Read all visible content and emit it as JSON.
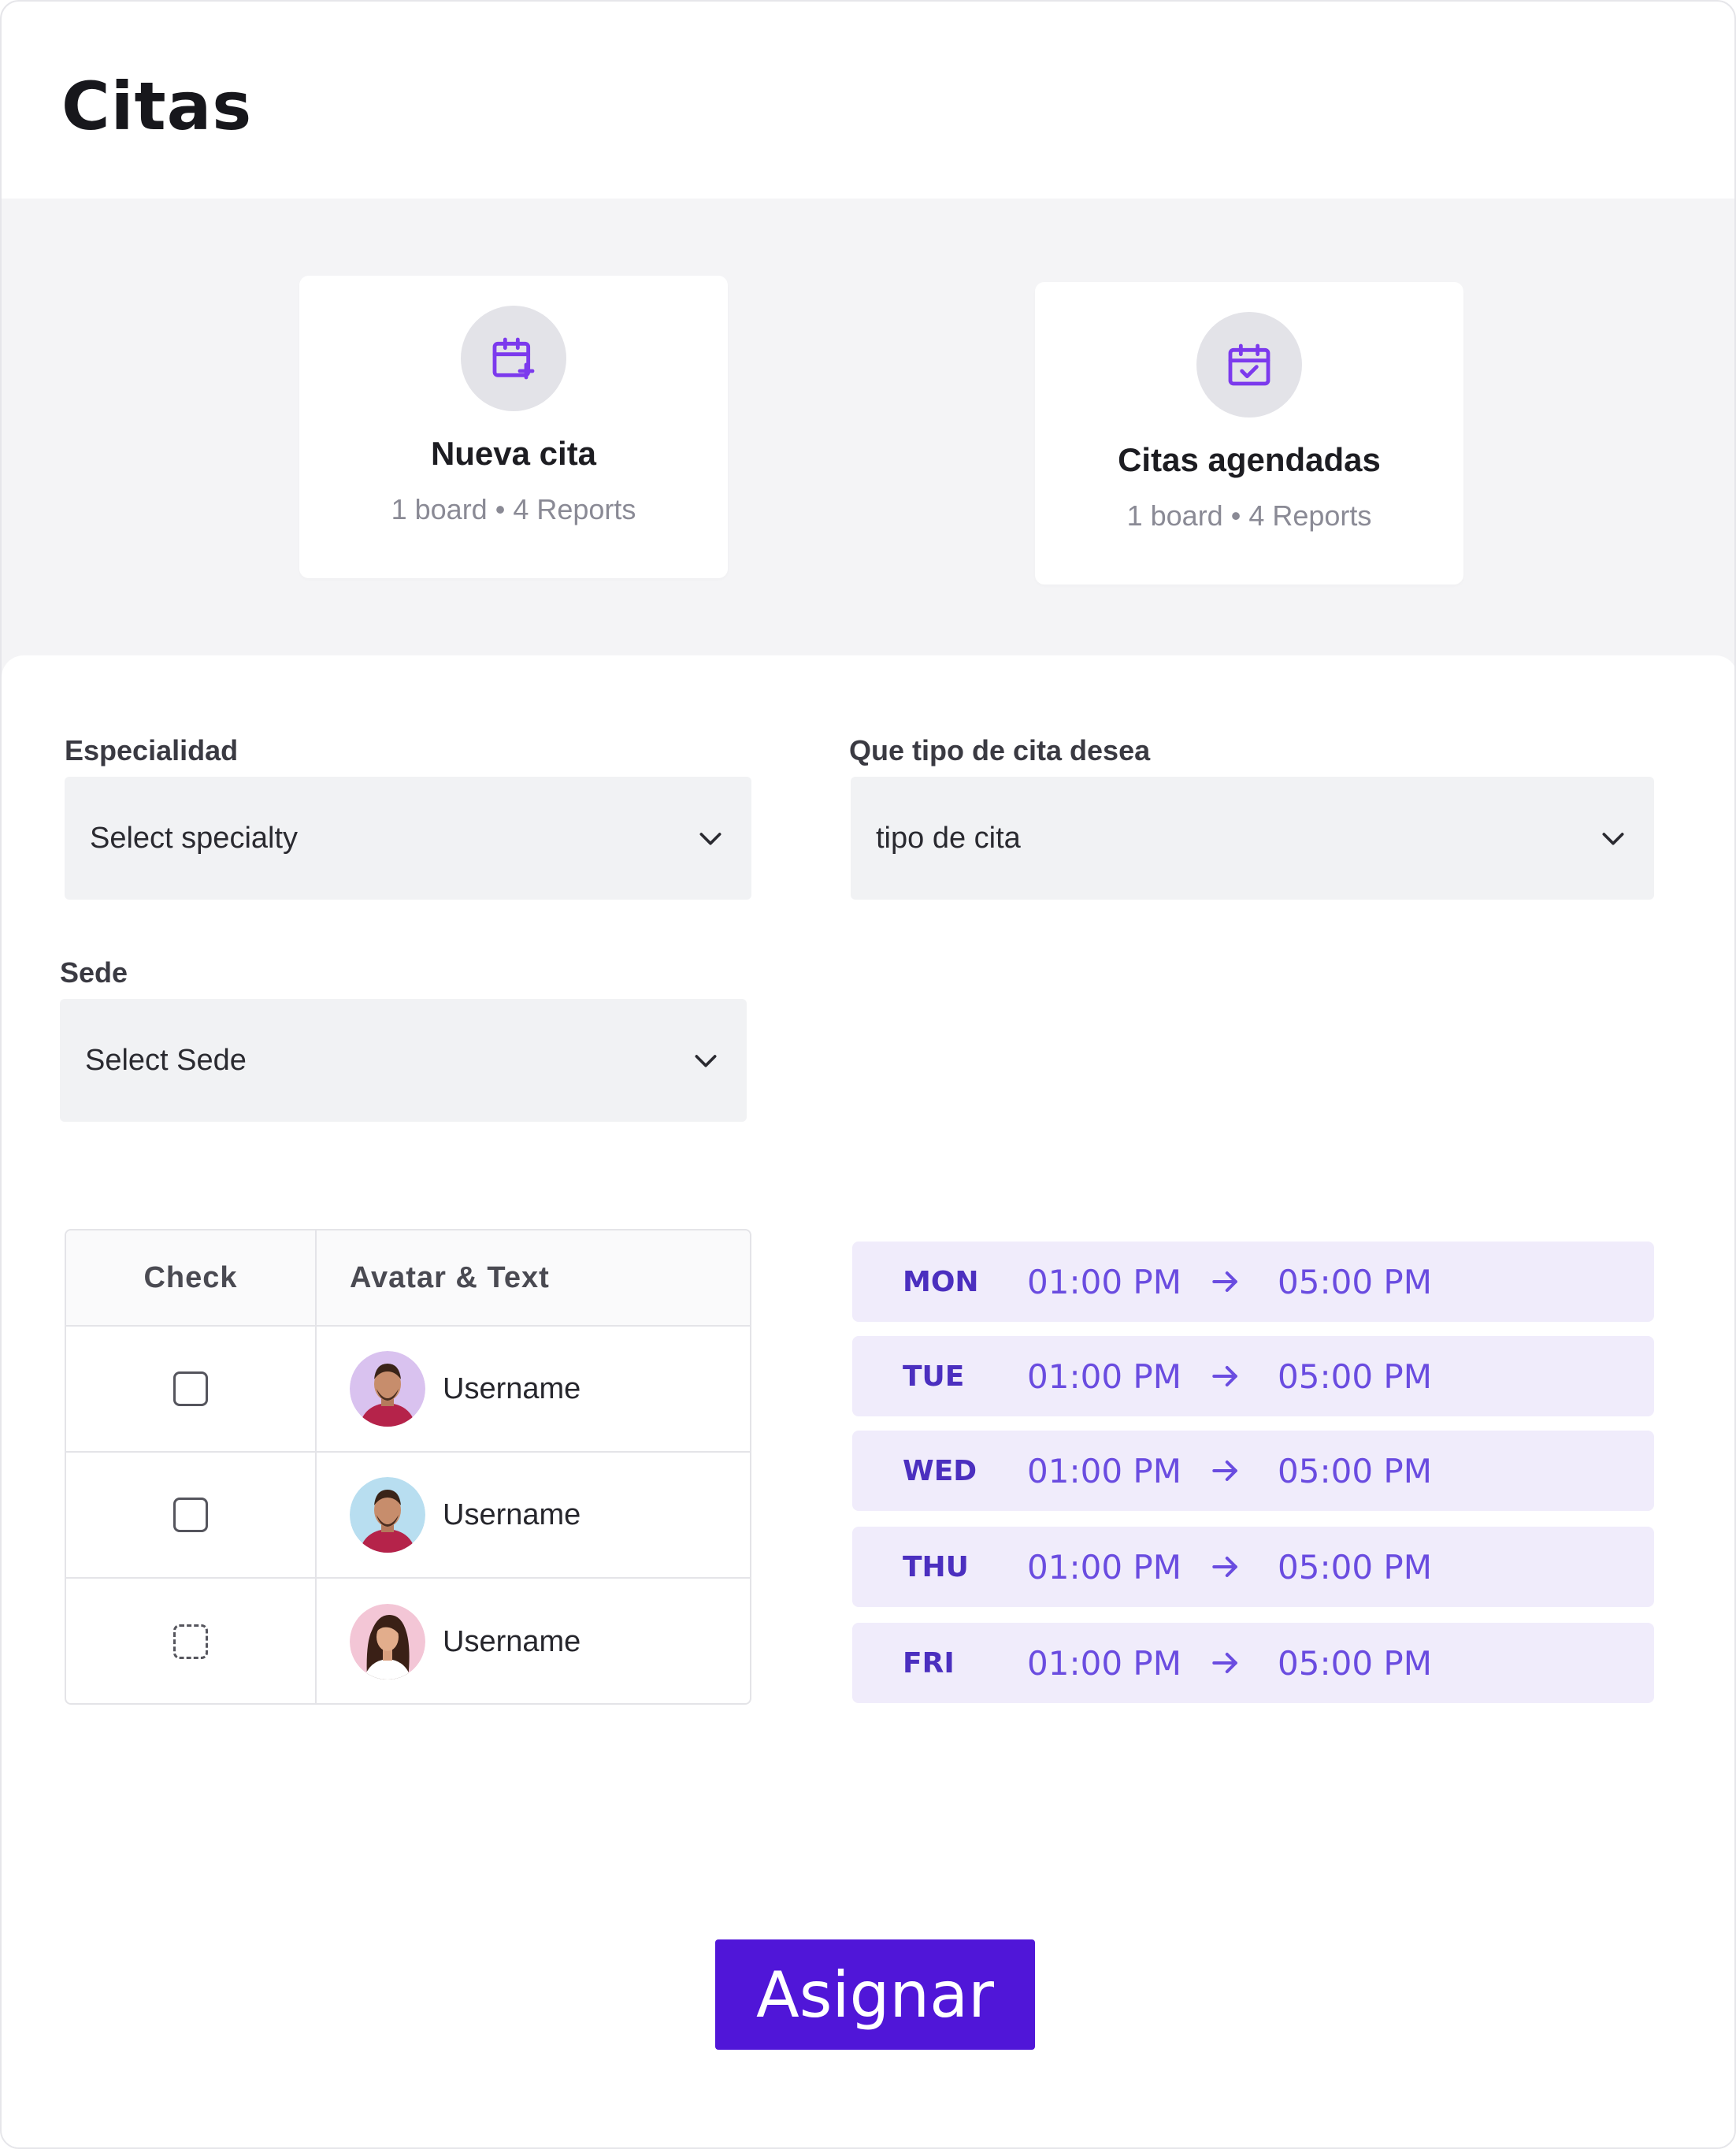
{
  "page": {
    "title": "Citas"
  },
  "cards": [
    {
      "title": "Nueva cita",
      "meta": "1 board • 4 Reports",
      "icon": "calendar-plus-icon"
    },
    {
      "title": "Citas agendadas",
      "meta": "1 board • 4 Reports",
      "icon": "calendar-check-icon"
    }
  ],
  "form": {
    "specialty": {
      "label": "Especialidad",
      "value": "Select  specialty"
    },
    "appointment_type": {
      "label": "Que tipo de cita desea",
      "value": "tipo de cita"
    },
    "site": {
      "label": "Sede",
      "value": "Select  Sede"
    }
  },
  "table": {
    "headers": {
      "check": "Check",
      "user": "Avatar & Text"
    },
    "rows": [
      {
        "username": "Username",
        "checked": false
      },
      {
        "username": "Username",
        "checked": false
      },
      {
        "username": "Username",
        "checked": false
      }
    ]
  },
  "schedule": [
    {
      "day": "MON",
      "from": "01:00 PM",
      "to": "05:00 PM"
    },
    {
      "day": "TUE",
      "from": "01:00 PM",
      "to": "05:00 PM"
    },
    {
      "day": "WED",
      "from": "01:00 PM",
      "to": "05:00 PM"
    },
    {
      "day": "THU",
      "from": "01:00 PM",
      "to": "05:00 PM"
    },
    {
      "day": "FRI",
      "from": "01:00 PM",
      "to": "05:00 PM"
    }
  ],
  "actions": {
    "assign_label": "Asignar"
  },
  "colors": {
    "accent": "#5016d8",
    "accent_light": "#f0ecfb",
    "icon_purple": "#7c3aed"
  }
}
